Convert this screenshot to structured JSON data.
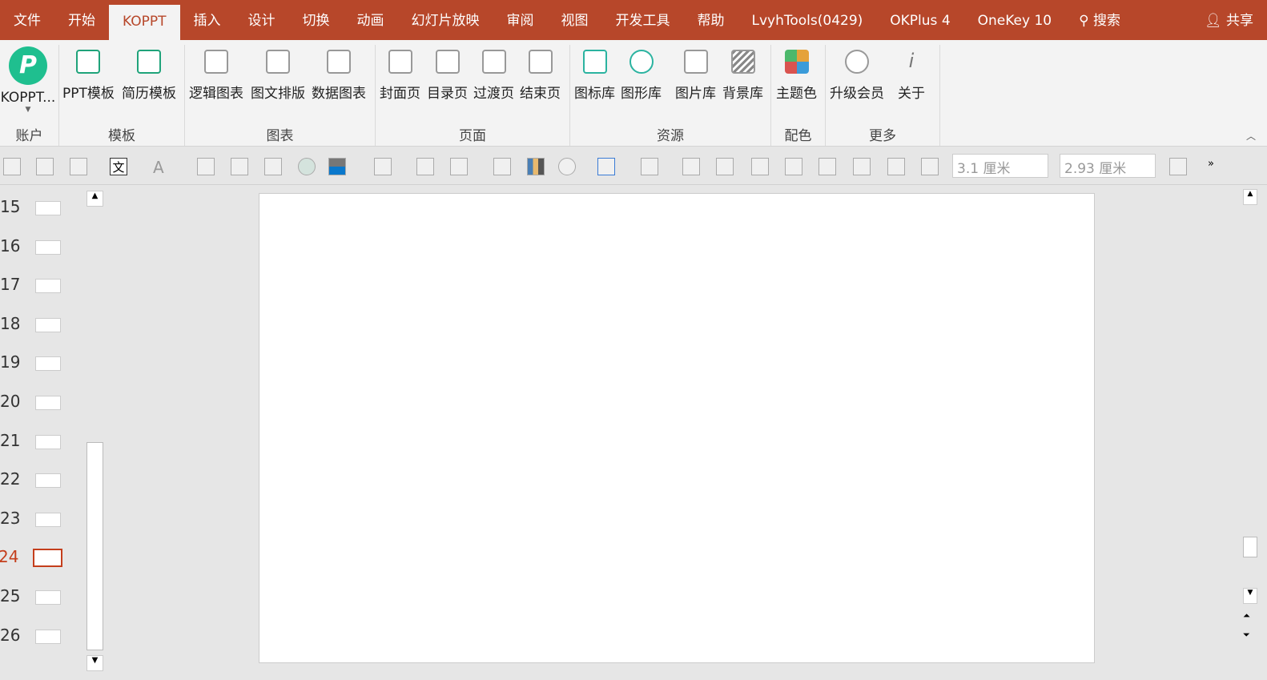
{
  "tabs": [
    "文件",
    "开始",
    "KOPPT",
    "插入",
    "设计",
    "切换",
    "动画",
    "幻灯片放映",
    "审阅",
    "视图",
    "开发工具",
    "帮助",
    "LvyhTools(0429)",
    "OKPlus 4",
    "OneKey 10",
    "搜索",
    "共享"
  ],
  "active_tab": "KOPPT",
  "ribbon": {
    "groups": [
      {
        "label": "账户",
        "buttons": [
          "KOPPT..."
        ]
      },
      {
        "label": "模板",
        "buttons": [
          "PPT模板",
          "简历模板"
        ]
      },
      {
        "label": "图表",
        "buttons": [
          "逻辑图表",
          "图文排版",
          "数据图表"
        ]
      },
      {
        "label": "页面",
        "buttons": [
          "封面页",
          "目录页",
          "过渡页",
          "结束页"
        ]
      },
      {
        "label": "资源",
        "buttons": [
          "图标库",
          "图形库",
          "图片库",
          "背景库"
        ]
      },
      {
        "label": "配色",
        "buttons": [
          "主题色"
        ]
      },
      {
        "label": "更多",
        "buttons": [
          "升级会员",
          "关于"
        ]
      }
    ]
  },
  "toolbar": {
    "width": "3.1 厘米",
    "height": "2.93 厘米"
  },
  "slides": [
    {
      "n": "15"
    },
    {
      "n": "16"
    },
    {
      "n": "17"
    },
    {
      "n": "18"
    },
    {
      "n": "19"
    },
    {
      "n": "20"
    },
    {
      "n": "21"
    },
    {
      "n": "22"
    },
    {
      "n": "23"
    },
    {
      "n": "24",
      "selected": true
    },
    {
      "n": "25"
    },
    {
      "n": "26"
    }
  ],
  "colors": {
    "accent": "#b7472a",
    "logo": "#1fbf8f"
  }
}
